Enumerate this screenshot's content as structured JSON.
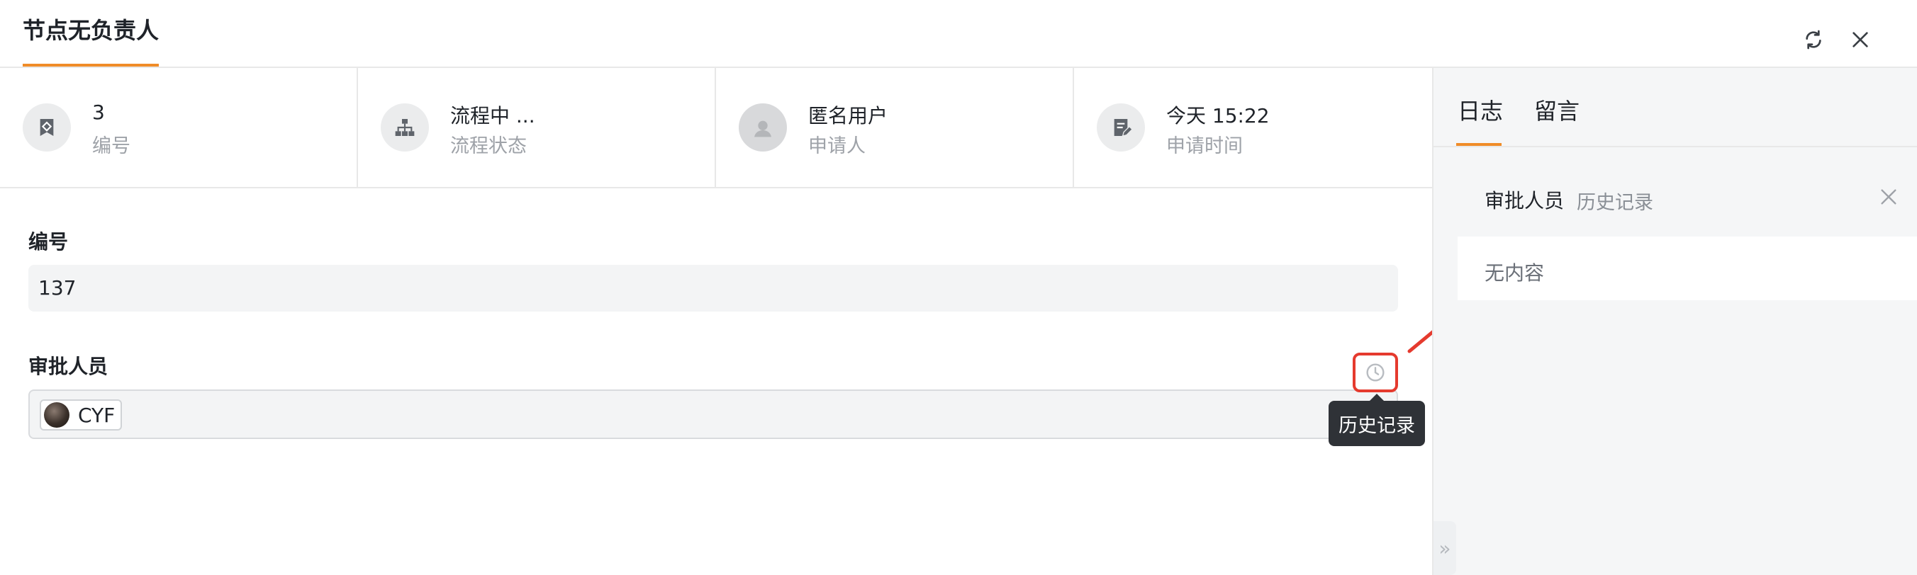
{
  "header": {
    "title": "节点无负责人",
    "refresh_icon": "refresh-icon",
    "close_icon": "close-icon",
    "accent_color": "#f08c28"
  },
  "info": [
    {
      "icon": "tag-icon",
      "value": "3",
      "label": "编号"
    },
    {
      "icon": "org-chart-icon",
      "value": "流程中 ...",
      "label": "流程状态"
    },
    {
      "icon": "user-avatar-icon",
      "value": "匿名用户",
      "label": "申请人"
    },
    {
      "icon": "edit-doc-icon",
      "value": "今天 15:22",
      "label": "申请时间"
    }
  ],
  "form": {
    "number_label": "编号",
    "number_value": "137",
    "approver_label": "审批人员",
    "approver_user": "CYF",
    "history_icon": "history-clock-icon",
    "history_tooltip": "历史记录"
  },
  "right_panel": {
    "tabs": [
      "日志",
      "留言"
    ],
    "active_tab": 0,
    "sub_title": "审批人员",
    "sub_tag": "历史记录",
    "empty_text": "无内容",
    "collapse_icon": "double-chevron-right-icon"
  },
  "annotation_color": "#e53a2e"
}
